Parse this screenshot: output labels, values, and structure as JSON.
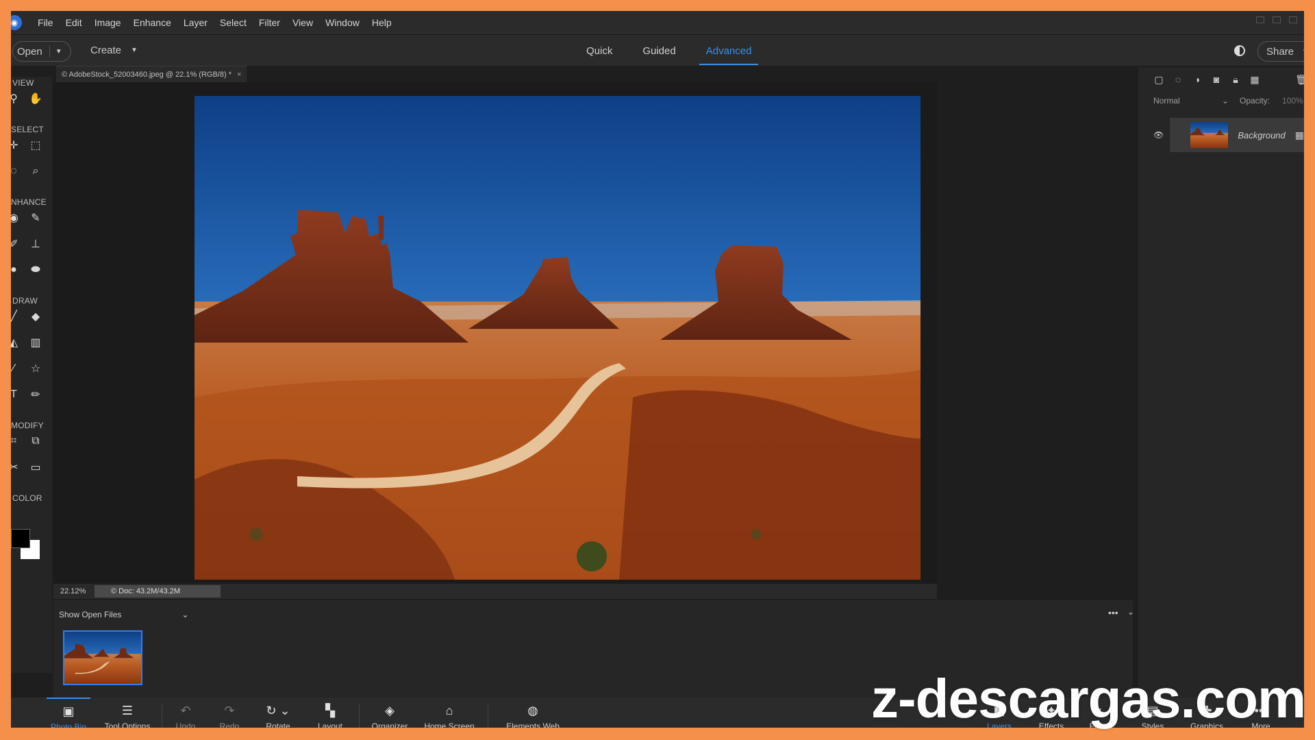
{
  "menubar": {
    "items": [
      "File",
      "Edit",
      "Image",
      "Enhance",
      "Layer",
      "Select",
      "Filter",
      "View",
      "Window",
      "Help"
    ]
  },
  "topbar": {
    "open_label": "Open",
    "create_label": "Create",
    "modes": [
      "Quick",
      "Guided",
      "Advanced"
    ],
    "active_mode": "Advanced",
    "share_label": "Share"
  },
  "toolbox": {
    "sections": [
      "VIEW",
      "SELECT",
      "NHANCE",
      "DRAW",
      "MODIFY",
      "COLOR"
    ]
  },
  "document": {
    "tab_title": "© AdobeStock_52003460.jpeg @ 22.1% (RGB/8) *",
    "close_symbol": "×"
  },
  "status": {
    "zoom": "22.12%",
    "doc_size": "© Doc: 43.2M/43.2M"
  },
  "photobin": {
    "selector_label": "Show Open Files",
    "more_symbol": "•••"
  },
  "taskbar": {
    "left": [
      {
        "label": "Photo Bin",
        "icon": "photo-bin-icon"
      },
      {
        "label": "Tool Options",
        "icon": "tool-options-icon"
      },
      {
        "label": "Undo",
        "icon": "undo-icon"
      },
      {
        "label": "Redo",
        "icon": "redo-icon"
      },
      {
        "label": "Rotate",
        "icon": "rotate-icon"
      },
      {
        "label": "Layout",
        "icon": "layout-icon"
      },
      {
        "label": "Organizer",
        "icon": "organizer-icon"
      },
      {
        "label": "Home Screen",
        "icon": "home-icon"
      },
      {
        "label": "Elements Web",
        "icon": "elements-web-icon"
      }
    ],
    "right": [
      {
        "label": "Layers",
        "icon": "layers-icon"
      },
      {
        "label": "Effects",
        "icon": "effects-icon"
      },
      {
        "label": "Filters",
        "icon": "filters-icon"
      },
      {
        "label": "Styles",
        "icon": "styles-icon"
      },
      {
        "label": "Graphics",
        "icon": "graphics-icon"
      },
      {
        "label": "More",
        "icon": "more-icon"
      }
    ]
  },
  "layers_panel": {
    "blend_mode": "Normal",
    "opacity_label": "Opacity:",
    "opacity_value": "100%",
    "layers": [
      {
        "name": "Background"
      }
    ]
  },
  "watermark": "z-descargas.com",
  "colors": {
    "accent": "#3d8fe8",
    "frame": "#f5904a",
    "panel": "#2b2b2b",
    "canvas_bg": "#1b1b1b"
  }
}
